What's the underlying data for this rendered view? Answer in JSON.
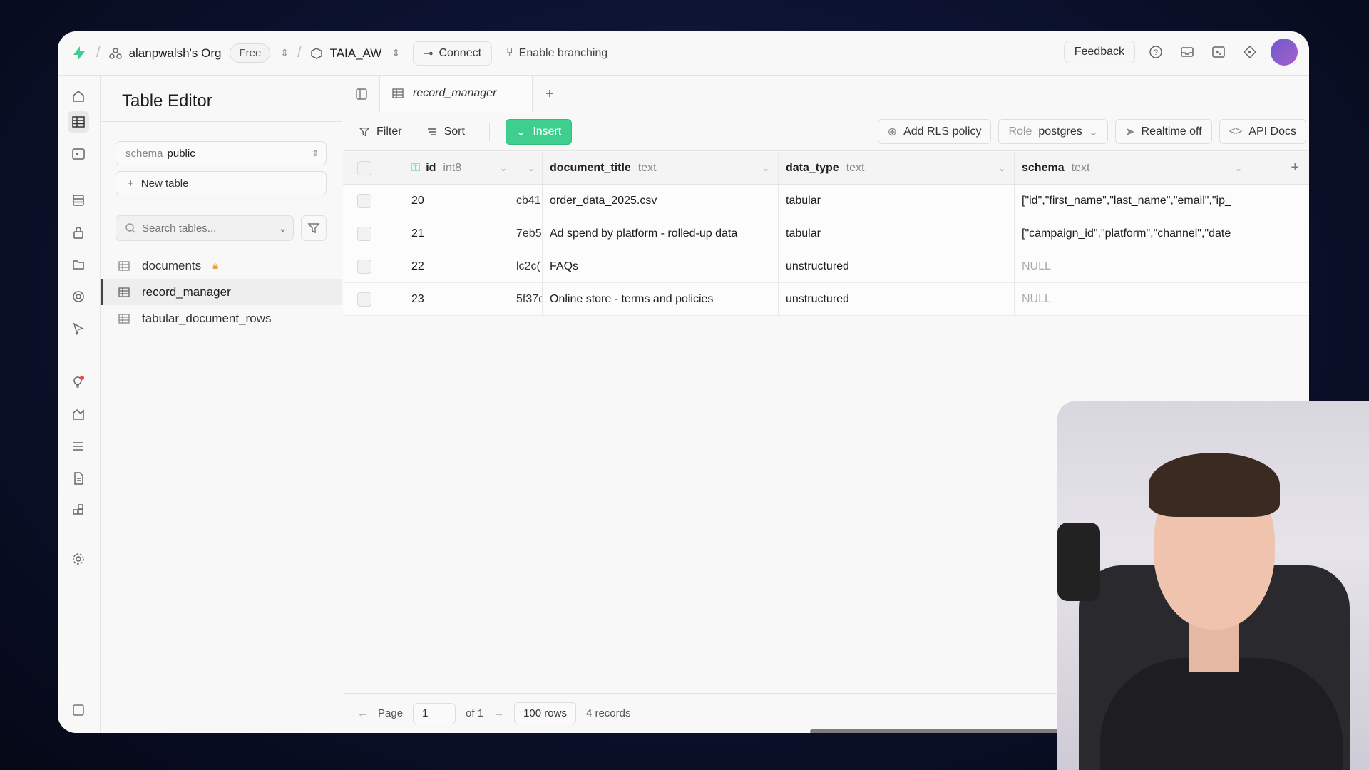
{
  "topbar": {
    "org_name": "alanpwalsh's Org",
    "plan_badge": "Free",
    "project_name": "TAIA_AW",
    "connect_label": "Connect",
    "branching_label": "Enable branching",
    "feedback_label": "Feedback"
  },
  "table_panel": {
    "title": "Table Editor",
    "schema_label": "schema",
    "schema_value": "public",
    "new_table_label": "New table",
    "search_placeholder": "Search tables...",
    "tables": [
      {
        "name": "documents",
        "locked": true
      },
      {
        "name": "record_manager",
        "active": true
      },
      {
        "name": "tabular_document_rows"
      }
    ]
  },
  "main": {
    "active_tab": "record_manager",
    "toolbar": {
      "filter_label": "Filter",
      "sort_label": "Sort",
      "insert_label": "Insert",
      "rls_label": "Add RLS policy",
      "role_label": "Role",
      "role_value": "postgres",
      "realtime_label": "Realtime off",
      "api_docs_label": "API Docs"
    },
    "columns": [
      {
        "name": "id",
        "type": "int8"
      },
      {
        "name": "",
        "type": ""
      },
      {
        "name": "document_title",
        "type": "text"
      },
      {
        "name": "data_type",
        "type": "text"
      },
      {
        "name": "schema",
        "type": "text"
      }
    ],
    "rows": [
      {
        "id": "20",
        "hidden": "cb41",
        "title": "order_data_2025.csv",
        "data_type": "tabular",
        "schema": "[\"id\",\"first_name\",\"last_name\",\"email\",\"ip_"
      },
      {
        "id": "21",
        "hidden": "7eb5",
        "title": "Ad spend by platform - rolled-up data",
        "data_type": "tabular",
        "schema": "[\"campaign_id\",\"platform\",\"channel\",\"date"
      },
      {
        "id": "22",
        "hidden": "lc2c(",
        "title": "FAQs",
        "data_type": "unstructured",
        "schema": "NULL"
      },
      {
        "id": "23",
        "hidden": "5f37c",
        "title": "Online store - terms and policies",
        "data_type": "unstructured",
        "schema": "NULL"
      }
    ],
    "footer": {
      "page_label": "Page",
      "page_value": "1",
      "of_label": "of 1",
      "rows_label": "100 rows",
      "records_label": "4 records"
    }
  },
  "colors": {
    "accent": "#3ecf8e",
    "lock": "#e6a23c"
  }
}
